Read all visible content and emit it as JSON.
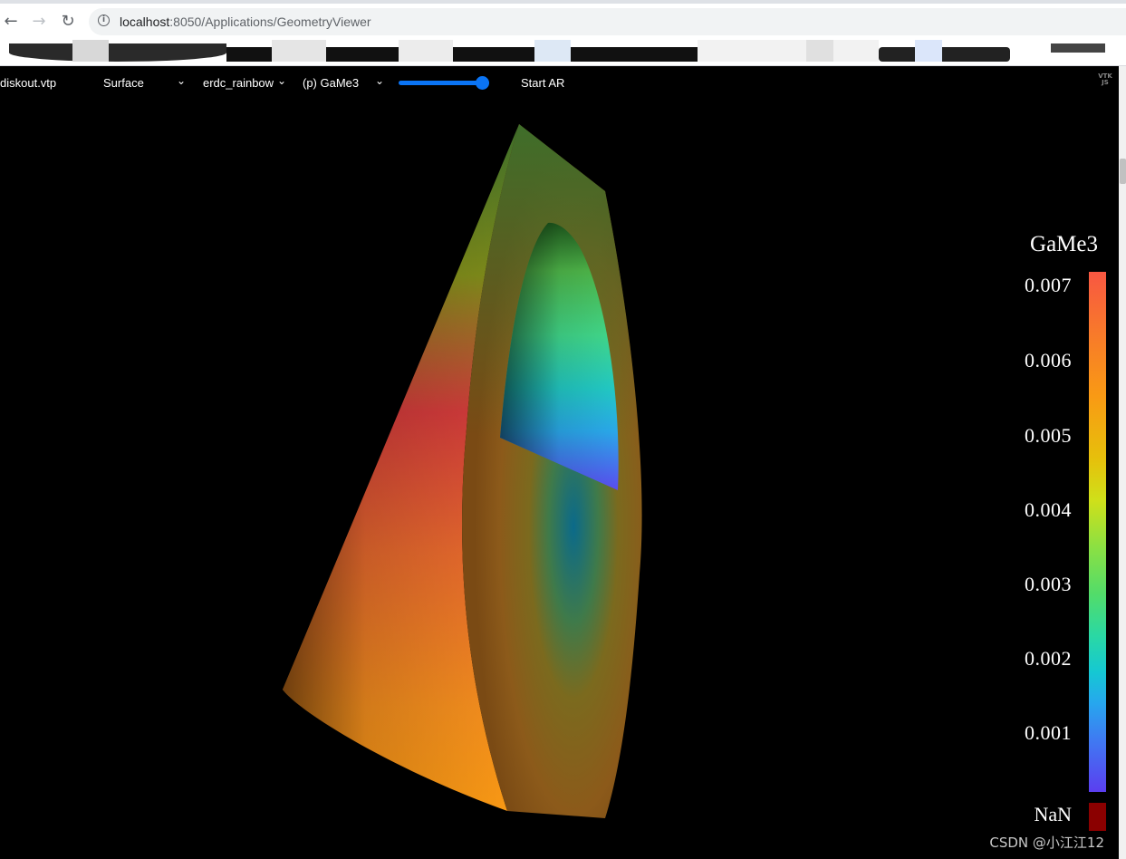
{
  "browser": {
    "url_host": "localhost",
    "url_path": ":8050/Applications/GeometryViewer",
    "back_icon": "←",
    "forward_icon": "→",
    "reload_icon": "↻",
    "info_icon": "i"
  },
  "toolbar": {
    "file_label": "diskout.vtp",
    "representation": "Surface",
    "colormap": "erdc_rainbow",
    "color_by": "(p) GaMe3",
    "opacity": 1.0,
    "ar_button": "Start AR",
    "logo_text": "VTK JS"
  },
  "legend": {
    "title": "GaMe3",
    "ticks": [
      "0.007",
      "0.006",
      "0.005",
      "0.004",
      "0.003",
      "0.002",
      "0.001"
    ],
    "nan_label": "NaN",
    "nan_color": "#8b0000",
    "colors": {
      "high": "#f85742",
      "mid": "#8be043",
      "low": "#5b3ef0"
    }
  },
  "watermark": "CSDN @小江江12"
}
